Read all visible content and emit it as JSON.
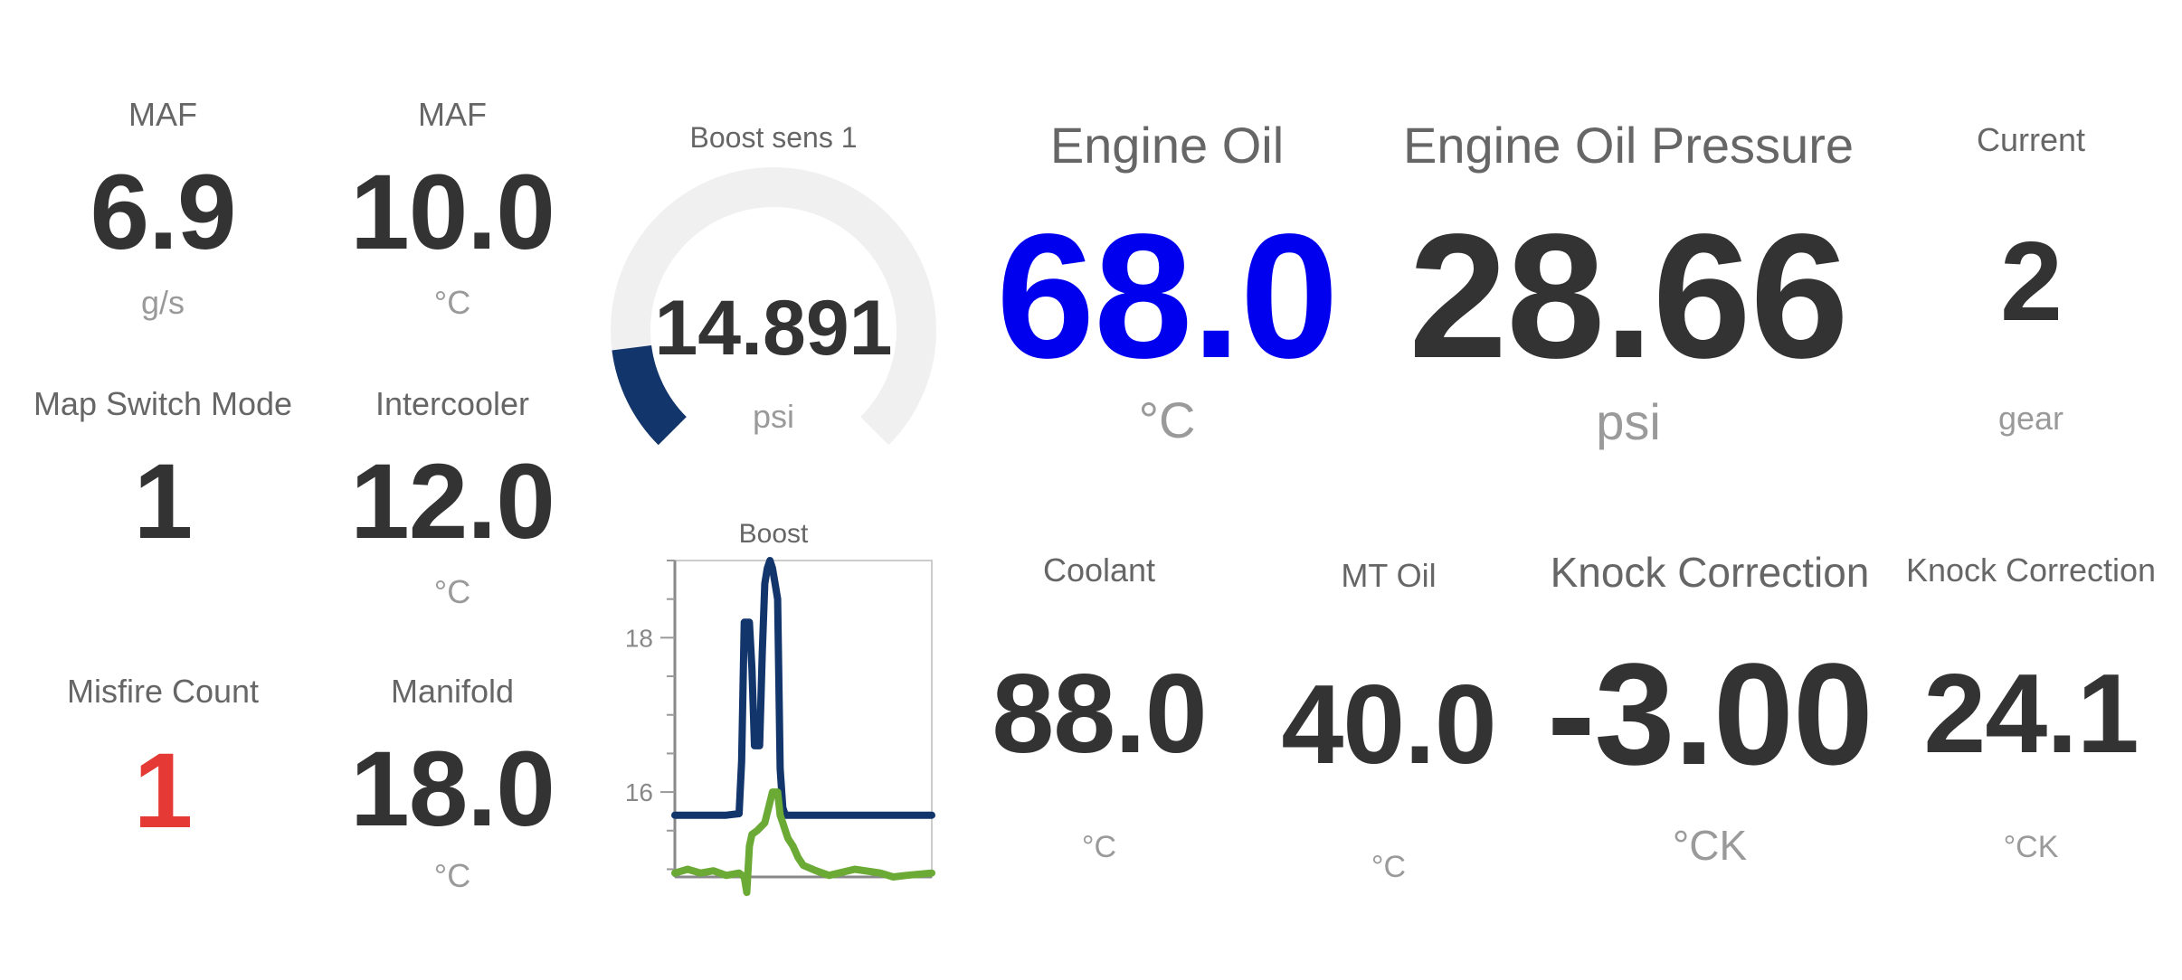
{
  "colors": {
    "text_dark": "#333333",
    "label": "#666666",
    "unit": "#9a9a9a",
    "highlight_blue": "#0000ee",
    "alert_red": "#e53935",
    "gauge_fill": "#12356b",
    "gauge_track": "#f0f0f0",
    "chart_line_1": "#12356b",
    "chart_line_2": "#6aaa35"
  },
  "widgets": {
    "maf_flow": {
      "label": "MAF",
      "value": "6.9",
      "unit": "g/s"
    },
    "maf_temp": {
      "label": "MAF",
      "value": "10.0",
      "unit": "°C"
    },
    "map_switch": {
      "label": "Map Switch Mode",
      "value": "1"
    },
    "intercooler": {
      "label": "Intercooler",
      "value": "12.0",
      "unit": "°C"
    },
    "misfire": {
      "label": "Misfire Count",
      "value": "1"
    },
    "manifold": {
      "label": "Manifold",
      "value": "18.0",
      "unit": "°C"
    },
    "boost_gauge": {
      "label": "Boost sens 1",
      "value": "14.891",
      "unit": "psi",
      "fraction": 0.14
    },
    "engine_oil": {
      "label": "Engine Oil",
      "value": "68.0",
      "unit": "°C"
    },
    "oil_pressure": {
      "label": "Engine Oil Pressure",
      "value": "28.66",
      "unit": "psi"
    },
    "current_gear": {
      "label": "Current",
      "value": "2",
      "unit": "gear"
    },
    "coolant": {
      "label": "Coolant",
      "value": "88.0",
      "unit": "°C"
    },
    "mt_oil": {
      "label": "MT Oil",
      "value": "40.0",
      "unit": "°C"
    },
    "knock_1": {
      "label": "Knock Correction",
      "value": "-3.00",
      "unit": "°CK"
    },
    "knock_2": {
      "label": "Knock Correction",
      "value": "24.1",
      "unit": "°CK"
    }
  },
  "chart_data": {
    "type": "line",
    "title": "Boost",
    "ylim": [
      14.9,
      19.0
    ],
    "xlim": [
      0,
      100
    ],
    "yticks": [
      "18",
      "16"
    ],
    "ytick_values": [
      18,
      16
    ],
    "grid": false,
    "series": [
      {
        "x": [
          0,
          10,
          20,
          25,
          26,
          27,
          29,
          30,
          31,
          33,
          34,
          35,
          36,
          37,
          38,
          39,
          40,
          41,
          42,
          43,
          44,
          45,
          47,
          50,
          60,
          70,
          80,
          90,
          100
        ],
        "y": [
          15.7,
          15.7,
          15.7,
          15.72,
          16.4,
          18.2,
          18.2,
          17.6,
          16.6,
          16.6,
          17.8,
          18.7,
          18.9,
          19.0,
          18.9,
          18.7,
          18.5,
          16.3,
          15.8,
          15.7,
          15.7,
          15.7,
          15.7,
          15.7,
          15.7,
          15.7,
          15.7,
          15.7,
          15.7
        ]
      },
      {
        "x": [
          0,
          5,
          10,
          15,
          20,
          25,
          27,
          28,
          29,
          30,
          32,
          35,
          38,
          40,
          41,
          42,
          43,
          44,
          46,
          48,
          50,
          55,
          60,
          70,
          80,
          85,
          90,
          100
        ],
        "y": [
          14.95,
          15.0,
          14.95,
          14.98,
          14.92,
          14.95,
          14.9,
          14.7,
          15.3,
          15.45,
          15.5,
          15.6,
          16.0,
          16.0,
          15.7,
          15.6,
          15.5,
          15.4,
          15.3,
          15.15,
          15.05,
          14.98,
          14.92,
          15.0,
          14.95,
          14.9,
          14.92,
          14.95
        ]
      }
    ]
  }
}
